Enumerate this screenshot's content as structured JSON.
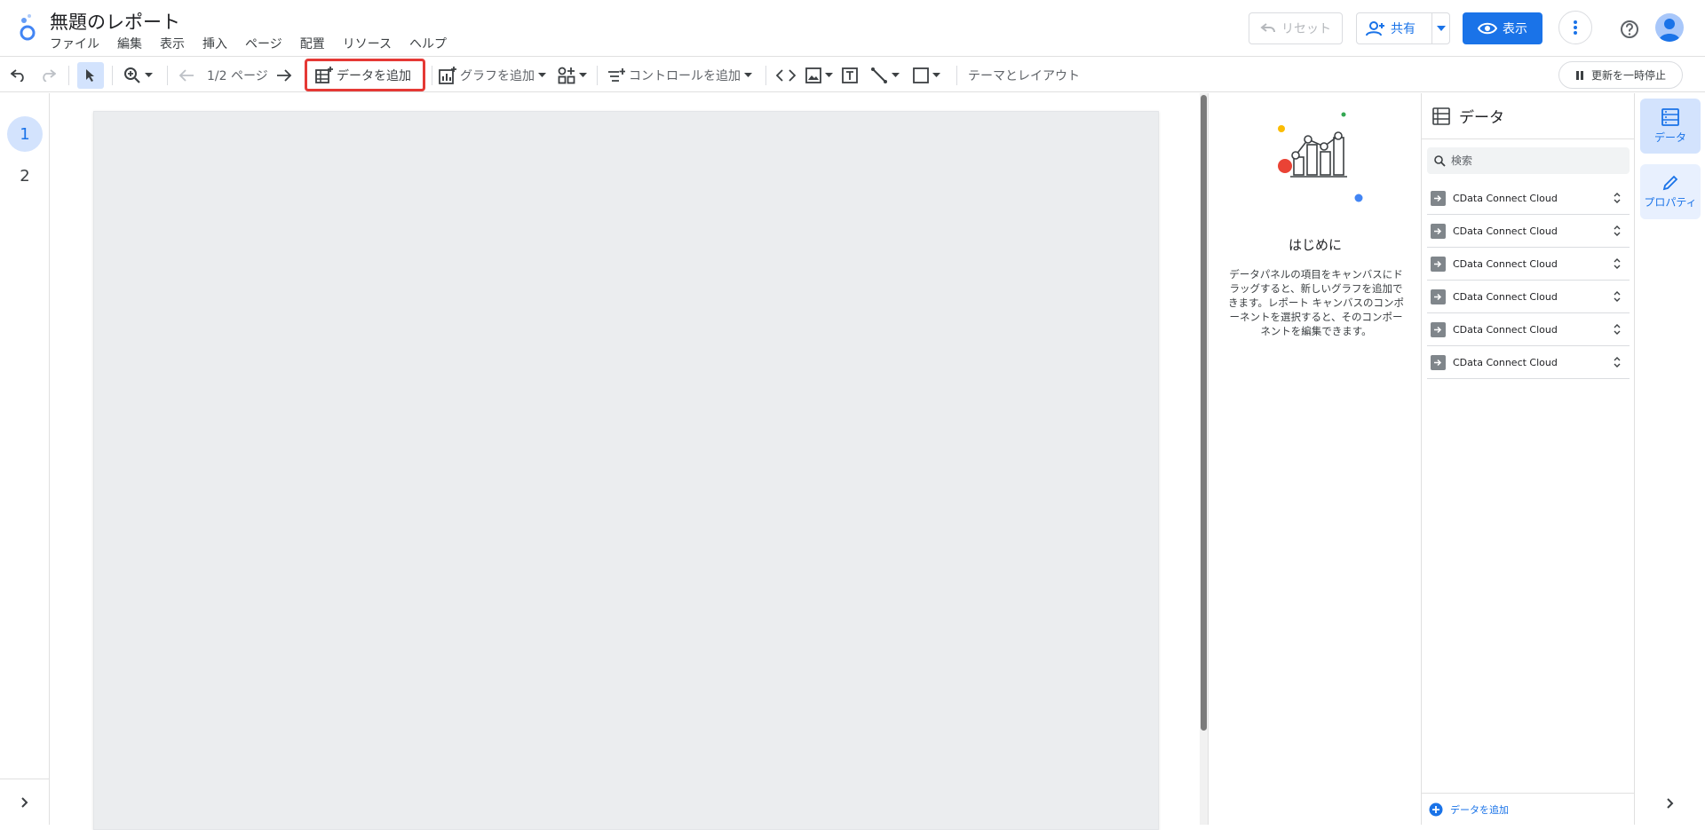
{
  "header": {
    "title": "無題のレポート",
    "menu": [
      "ファイル",
      "編集",
      "表示",
      "挿入",
      "ページ",
      "配置",
      "リソース",
      "ヘルプ"
    ],
    "reset_label": "リセット",
    "share_label": "共有",
    "view_label": "表示"
  },
  "toolbar": {
    "page_indicator": "1/2 ページ",
    "add_data_label": "データを追加",
    "add_chart_label": "グラフを追加",
    "add_control_label": "コントロールを追加",
    "theme_label": "テーマとレイアウト",
    "pause_label": "更新を一時停止"
  },
  "pages": [
    "1",
    "2"
  ],
  "intro": {
    "title": "はじめに",
    "text": "データパネルの項目をキャンバスにドラッグすると、新しいグラフを追加できます。レポート キャンバスのコンポーネントを選択すると、そのコンポーネントを編集できます。"
  },
  "data_panel": {
    "title": "データ",
    "search_placeholder": "検索",
    "sources": [
      "CData Connect Cloud",
      "CData Connect Cloud",
      "CData Connect Cloud",
      "CData Connect Cloud",
      "CData Connect Cloud",
      "CData Connect Cloud"
    ],
    "footer_add_label": "データを追加"
  },
  "rail": {
    "data_label": "データ",
    "props_label": "プロパティ"
  },
  "colors": {
    "accent": "#1a73e8",
    "highlight_border": "#e53935",
    "canvas": "#ebedef"
  }
}
